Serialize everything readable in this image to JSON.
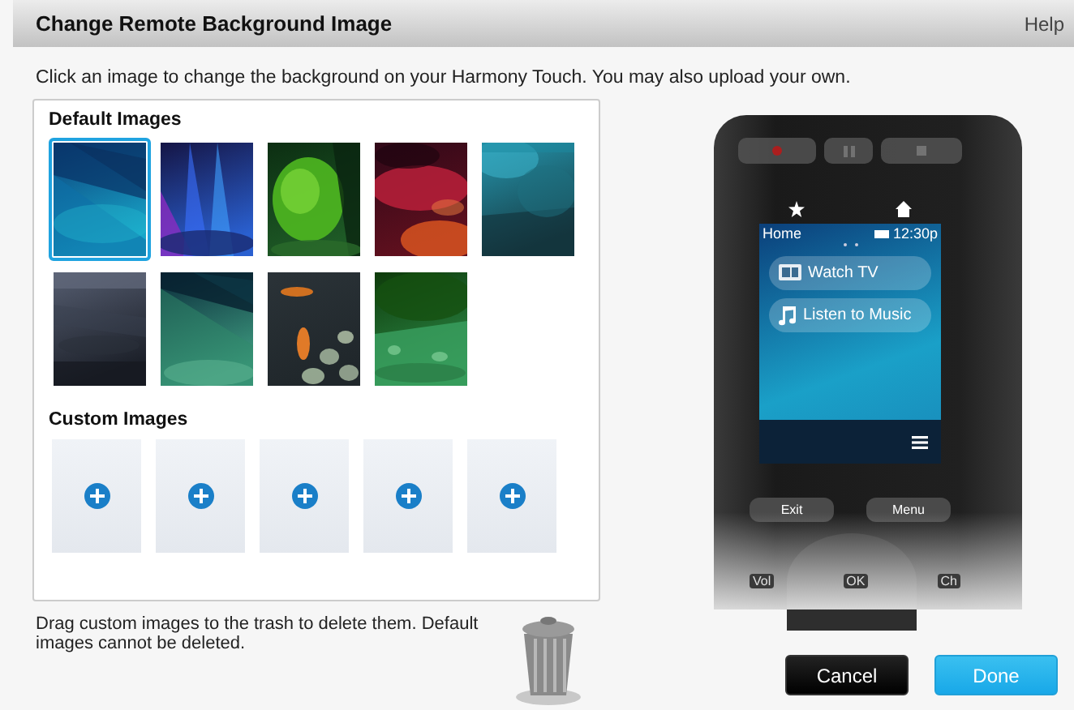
{
  "header": {
    "title": "Change Remote Background Image",
    "help": "Help"
  },
  "intro": "Click an image to change the background on your Harmony Touch. You may also upload your own.",
  "default_images": {
    "title": "Default Images",
    "items": [
      {
        "kind": "picture",
        "selected": true
      },
      {
        "kind": "picture",
        "selected": false
      },
      {
        "kind": "picture",
        "selected": false
      },
      {
        "kind": "picture",
        "selected": false
      },
      {
        "kind": "picture",
        "selected": false
      },
      {
        "kind": "picture",
        "selected": false
      },
      {
        "kind": "picture",
        "selected": false
      },
      {
        "kind": "picture",
        "selected": false
      },
      {
        "kind": "picture",
        "selected": false
      }
    ]
  },
  "custom_images": {
    "title": "Custom Images",
    "slots": [
      {
        "kind": "add"
      },
      {
        "kind": "add"
      },
      {
        "kind": "add"
      },
      {
        "kind": "add"
      },
      {
        "kind": "add"
      }
    ]
  },
  "remote": {
    "screen_title": "Home",
    "clock": "12:30p",
    "activities": [
      {
        "label": "Watch TV",
        "kind": "tv"
      },
      {
        "label": "Listen to Music",
        "kind": "music"
      }
    ],
    "buttons": [
      "Exit",
      "Menu"
    ],
    "faded_labels": [
      "Vol",
      "OK",
      "Ch"
    ]
  },
  "footer_note": "Drag custom images to the trash to delete them. Default images cannot be deleted.",
  "actions": [
    {
      "label": "Cancel",
      "kind": "secondary"
    },
    {
      "label": "Done",
      "kind": "primary"
    }
  ]
}
